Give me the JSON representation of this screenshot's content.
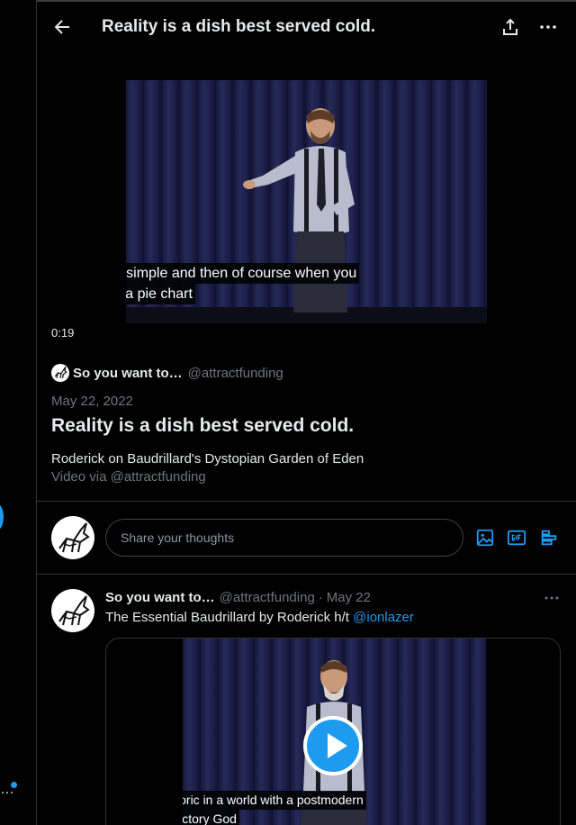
{
  "header": {
    "title": "Reality is a dish best served cold."
  },
  "main_video": {
    "caption_line1": "that simple and then of course when you",
    "caption_line2": "see a pie chart",
    "elapsed": "0:19"
  },
  "source": {
    "name": "So you want to…",
    "handle": "@attractfunding"
  },
  "post": {
    "date": "May 22, 2022",
    "headline": "Reality is a dish best served cold.",
    "description": "Roderick on Baudrillard's Dystopian Garden of Eden",
    "credit": "Video via @attractfunding"
  },
  "reply": {
    "placeholder": "Share your thoughts"
  },
  "tweet": {
    "name": "So you want to…",
    "handle": "@attractfunding",
    "separator": "·",
    "time": "May 22",
    "text": "The Essential Baudrillard by Roderick h/t ",
    "mention": "@ionlazer",
    "caption_line1": "rhetoric in a world with a postmodern",
    "caption_line2": "trajectory God"
  },
  "left_rail": {
    "more_label": "…"
  },
  "colors": {
    "accent": "#1d9bf0",
    "background": "#000000",
    "muted": "#71767b",
    "border": "#2f3336"
  }
}
